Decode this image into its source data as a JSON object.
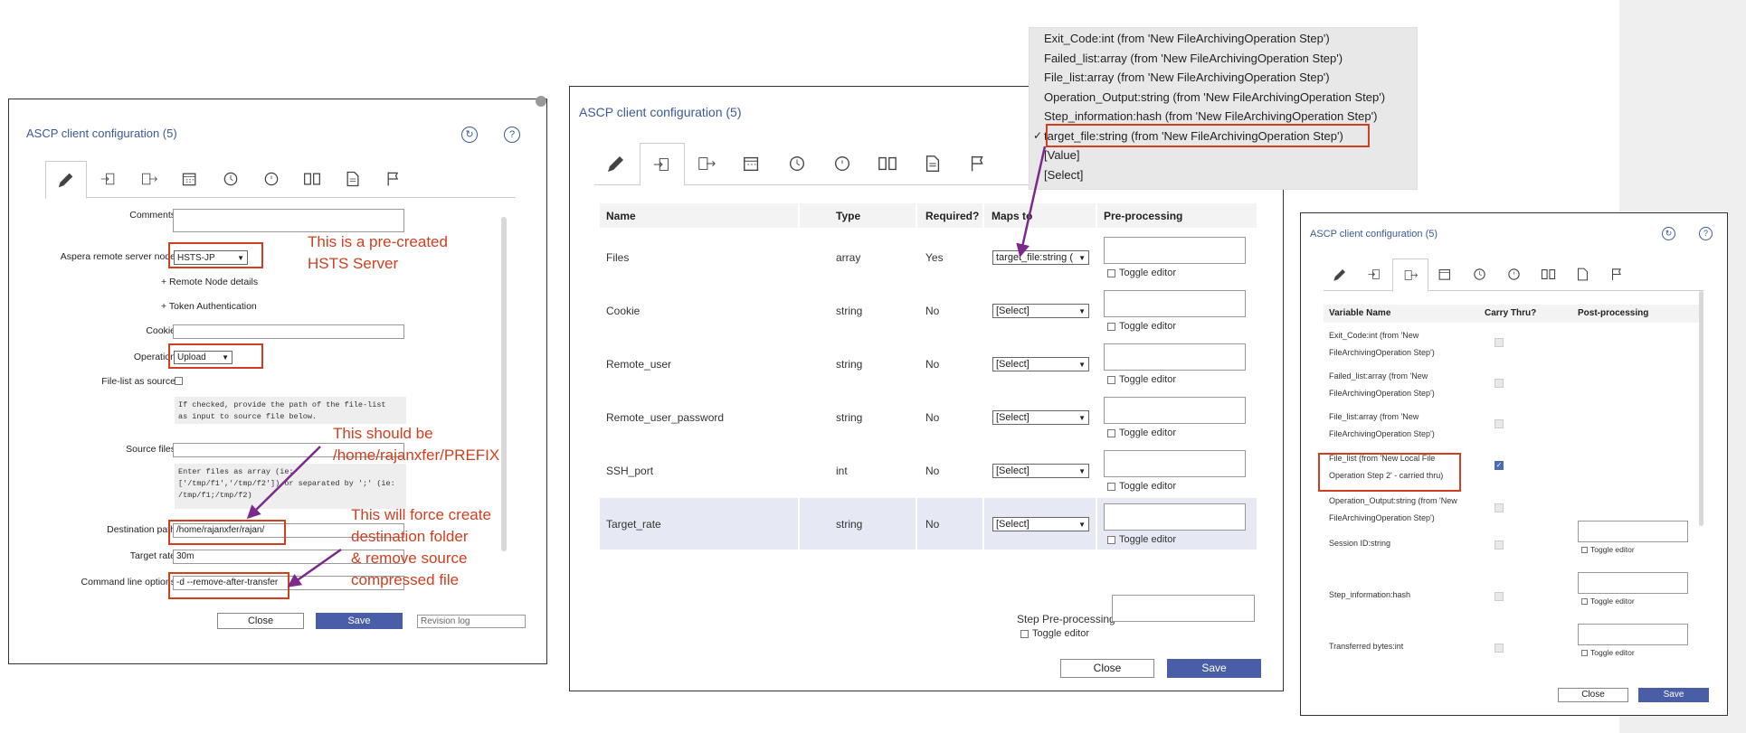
{
  "dialog1": {
    "title": "ASCP client configuration (5)",
    "labels": {
      "comments": "Comments",
      "server_node": "Aspera remote server node",
      "remote_node_details": "+ Remote Node details",
      "token_auth": "+ Token Authentication",
      "cookie": "Cookie",
      "operation": "Operation",
      "file_list_source": "File-list as source",
      "source_files": "Source files",
      "destination_path": "Destination path",
      "target_rate": "Target rate",
      "cmd_options": "Command line options"
    },
    "server_node_value": "HSTS-JP",
    "operation_value": "Upload",
    "file_list_help": "If checked, provide the path of the file-list\nas input to source file below.",
    "source_files_help": "Enter files as array (ie:\n['/tmp/f1','/tmp/f2']) or separated by ';' (ie:\n/tmp/f1;/tmp/f2)",
    "destination_path_value": "/home/rajanxfer/rajan/",
    "target_rate_value": "30m",
    "cmd_options_value": "-d --remove-after-transfer",
    "close": "Close",
    "save": "Save",
    "revision_placeholder": "Revision log"
  },
  "annotations": {
    "a1": [
      "This is a pre-created",
      "HSTS Server"
    ],
    "a2": [
      "This should be",
      "/home/rajanxfer/PREFIX"
    ],
    "a3": [
      "This will force create",
      "destination folder",
      "& remove source",
      "compressed file"
    ]
  },
  "dialog2": {
    "title": "ASCP client configuration (5)",
    "headers": [
      "Name",
      "Type",
      "Required?",
      "Maps to",
      "Pre-processing"
    ],
    "rows": [
      {
        "name": "Files",
        "type": "array",
        "required": "Yes",
        "maps": "target_file:string ("
      },
      {
        "name": "Cookie",
        "type": "string",
        "required": "No",
        "maps": "[Select]"
      },
      {
        "name": "Remote_user",
        "type": "string",
        "required": "No",
        "maps": "[Select]"
      },
      {
        "name": "Remote_user_password",
        "type": "string",
        "required": "No",
        "maps": "[Select]"
      },
      {
        "name": "SSH_port",
        "type": "int",
        "required": "No",
        "maps": "[Select]"
      },
      {
        "name": "Target_rate",
        "type": "string",
        "required": "No",
        "maps": "[Select]"
      }
    ],
    "toggle_editor": "Toggle editor",
    "step_preprocessing": "Step Pre-processing",
    "close": "Close",
    "save": "Save"
  },
  "dropdown": {
    "items": [
      "Exit_Code:int (from 'New FileArchivingOperation Step')",
      "Failed_list:array (from 'New FileArchivingOperation Step')",
      "File_list:array (from 'New FileArchivingOperation Step')",
      "Operation_Output:string (from 'New FileArchivingOperation Step')",
      "Step_information:hash (from 'New FileArchivingOperation Step')",
      "target_file:string (from 'New FileArchivingOperation Step')",
      "[Value]",
      "[Select]"
    ],
    "selected_index": 5,
    "check": "✓"
  },
  "dialog3": {
    "title": "ASCP client configuration (5)",
    "headers": [
      "Variable Name",
      "Carry Thru?",
      "Post-processing"
    ],
    "rows": [
      {
        "l1": "Exit_Code:int (from 'New",
        "l2": "FileArchivingOperation Step')"
      },
      {
        "l1": "Failed_list:array (from 'New",
        "l2": "FileArchivingOperation Step')"
      },
      {
        "l1": "File_list:array (from 'New",
        "l2": "FileArchivingOperation Step')"
      },
      {
        "l1": "File_list (from 'New Local File",
        "l2": "Operation Step 2' - carried thru)"
      },
      {
        "l1": "Operation_Output:string (from 'New",
        "l2": "FileArchivingOperation Step')"
      },
      {
        "l1": "Session ID:string",
        "l2": ""
      },
      {
        "l1": "Step_information:hash",
        "l2": ""
      },
      {
        "l1": "Transferred bytes:int",
        "l2": ""
      }
    ],
    "toggle_editor": "Toggle editor",
    "close": "Close",
    "save": "Save"
  },
  "colors": {
    "accent": "#3b5a99",
    "annotation": "#d04020",
    "arrow": "#7b2a8c",
    "save": "#4a5ea8"
  }
}
